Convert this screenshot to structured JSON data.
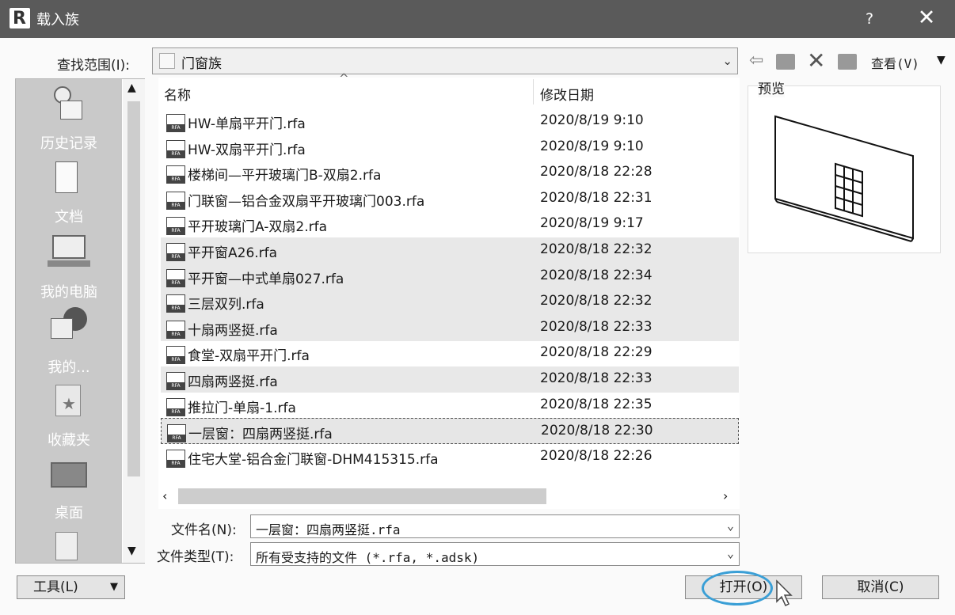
{
  "window": {
    "app_icon": "R",
    "title": "载入族",
    "help": "?",
    "close": "✕"
  },
  "lookin": {
    "label": "查找范围(I):",
    "value": "门窗族"
  },
  "toolbar": {
    "back_icon": "arrow-left-icon",
    "up_icon": "folder-up-icon",
    "delete_icon": "delete-icon",
    "newfolder_icon": "new-folder-icon",
    "view_label": "查看(V)"
  },
  "places": [
    {
      "label": "历史记录",
      "icon": "history-icon"
    },
    {
      "label": "文档",
      "icon": "documents-icon"
    },
    {
      "label": "我的电脑",
      "icon": "computer-icon"
    },
    {
      "label": "我的...",
      "icon": "network-icon"
    },
    {
      "label": "收藏夹",
      "icon": "favorites-icon"
    },
    {
      "label": "桌面",
      "icon": "desktop-icon"
    }
  ],
  "list": {
    "col_name": "名称",
    "col_date": "修改日期",
    "files": [
      {
        "name": "HW-单扇平开门.rfa",
        "date": "2020/8/19 9:10"
      },
      {
        "name": "HW-双扇平开门.rfa",
        "date": "2020/8/19 9:10"
      },
      {
        "name": "楼梯间—平开玻璃门B-双扇2.rfa",
        "date": "2020/8/18 22:28"
      },
      {
        "name": "门联窗—铝合金双扇平开玻璃门003.rfa",
        "date": "2020/8/18 22:31"
      },
      {
        "name": "平开玻璃门A-双扇2.rfa",
        "date": "2020/8/19 9:17"
      },
      {
        "name": "平开窗A26.rfa",
        "date": "2020/8/18 22:32"
      },
      {
        "name": "平开窗—中式单扇027.rfa",
        "date": "2020/8/18 22:34"
      },
      {
        "name": "三层双列.rfa",
        "date": "2020/8/18 22:32"
      },
      {
        "name": "十扇两竖挺.rfa",
        "date": "2020/8/18 22:33"
      },
      {
        "name": "食堂-双扇平开门.rfa",
        "date": "2020/8/18 22:29"
      },
      {
        "name": "四扇两竖挺.rfa",
        "date": "2020/8/18 22:33"
      },
      {
        "name": "推拉门-单扇-1.rfa",
        "date": "2020/8/18 22:35"
      },
      {
        "name": "一层窗：四扇两竖挺.rfa",
        "date": "2020/8/18 22:30"
      },
      {
        "name": "住宅大堂-铝合金门联窗-DHM415315.rfa",
        "date": "2020/8/18 22:26"
      }
    ],
    "file_icon_text": "RFA"
  },
  "preview": {
    "label": "预览"
  },
  "filename": {
    "label": "文件名(N):",
    "value": "一层窗：四扇两竖挺.rfa"
  },
  "filetype": {
    "label": "文件类型(T):",
    "value": "所有受支持的文件 (*.rfa, *.adsk)"
  },
  "buttons": {
    "tools": "工具(L)",
    "open": "打开(O)",
    "cancel": "取消(C)"
  },
  "colors": {
    "titlebar": "#5a5a5a",
    "places": "#c9c9c9",
    "highlight_circle": "#3a9fd6"
  }
}
